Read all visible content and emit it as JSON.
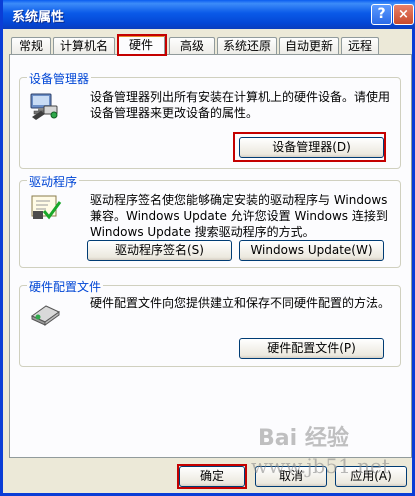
{
  "window": {
    "title": "系统属性",
    "help_glyph": "?",
    "close_glyph": "×"
  },
  "tabs": [
    "常规",
    "计算机名",
    "硬件",
    "高级",
    "系统还原",
    "自动更新",
    "远程"
  ],
  "active_tab": "硬件",
  "device_manager": {
    "legend": "设备管理器",
    "description": "设备管理器列出所有安装在计算机上的硬件设备。请使用设备管理器来更改设备的属性。",
    "button": "设备管理器(D)"
  },
  "driver": {
    "legend": "驱动程序",
    "description": "驱动程序签名使您能够确定安装的驱动程序与 Windows 兼容。Windows Update 允许您设置 Windows 连接到 Windows Update 搜索驱动程序的方式。",
    "signing_button": "驱动程序签名(S)",
    "update_button": "Windows Update(W)"
  },
  "hw_profiles": {
    "legend": "硬件配置文件",
    "description": "硬件配置文件向您提供建立和保存不同硬件配置的方法。",
    "button": "硬件配置文件(P)"
  },
  "footer": {
    "ok": "确定",
    "cancel": "取消",
    "apply": "应用(A)"
  },
  "watermark": {
    "brand": "Bai 经验",
    "site": "www.jb51.net"
  },
  "colors": {
    "titlebar": "#0a5ae8",
    "highlight": "#c40000",
    "legend": "#0046d5",
    "panel": "#fcfcfe",
    "dialog": "#ece9d8"
  }
}
